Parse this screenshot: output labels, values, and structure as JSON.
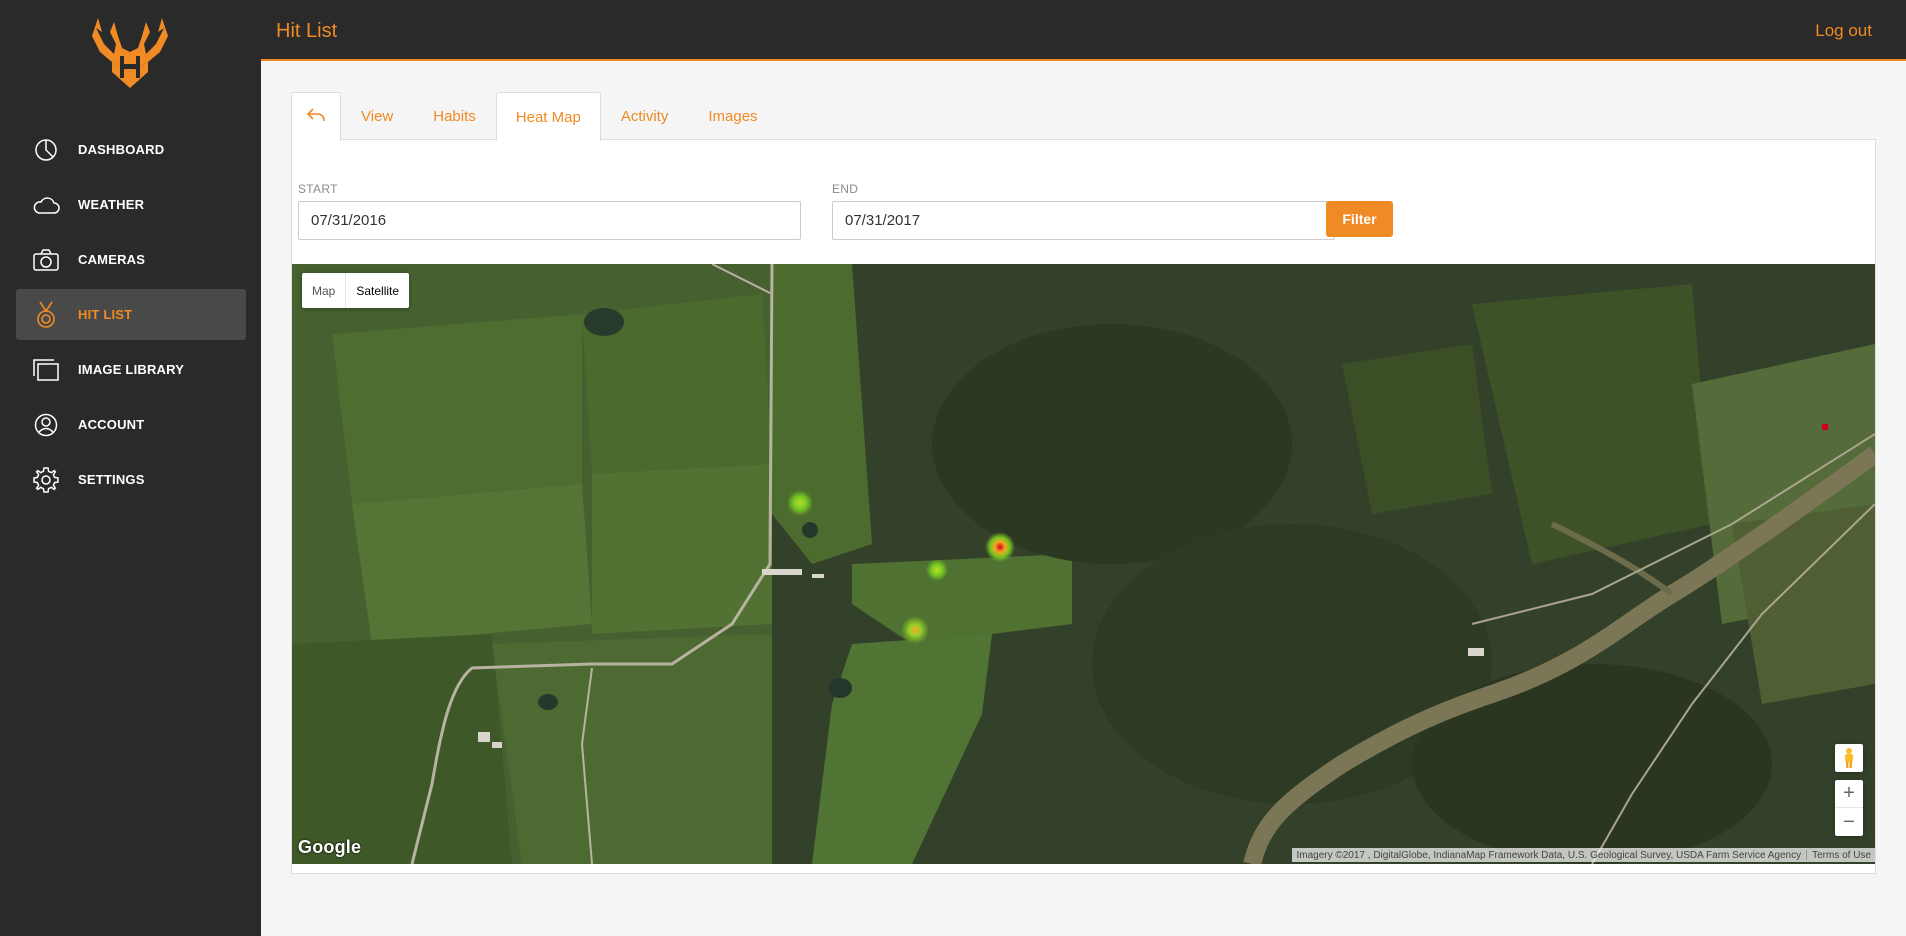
{
  "header": {
    "title": "Hit List",
    "logout_label": "Log out"
  },
  "sidebar": {
    "items": [
      {
        "label": "DASHBOARD",
        "icon": "dashboard-pie-icon",
        "active": false
      },
      {
        "label": "WEATHER",
        "icon": "cloud-icon",
        "active": false
      },
      {
        "label": "CAMERAS",
        "icon": "camera-icon",
        "active": false
      },
      {
        "label": "HIT LIST",
        "icon": "medal-icon",
        "active": true
      },
      {
        "label": "IMAGE LIBRARY",
        "icon": "image-library-icon",
        "active": false
      },
      {
        "label": "ACCOUNT",
        "icon": "account-icon",
        "active": false
      },
      {
        "label": "SETTINGS",
        "icon": "gear-icon",
        "active": false
      }
    ]
  },
  "tabs": [
    {
      "label": "View"
    },
    {
      "label": "Habits"
    },
    {
      "label": "Heat Map",
      "active": true
    },
    {
      "label": "Activity"
    },
    {
      "label": "Images"
    }
  ],
  "filter": {
    "start_label": "START",
    "start_value": "07/31/2016",
    "end_label": "END",
    "end_value": "07/31/2017",
    "button_label": "Filter"
  },
  "map": {
    "type_map_label": "Map",
    "type_satellite_label": "Satellite",
    "selected_type": "Satellite",
    "google_label": "Google",
    "attribution": "Imagery ©2017 , DigitalGlobe, IndianaMap Framework Data, U.S. Geological Survey, USDA Farm Service Agency",
    "terms_label": "Terms of Use",
    "zoom_in_label": "+",
    "zoom_out_label": "−"
  },
  "colors": {
    "accent": "#f08a24",
    "sidebar_bg": "#2a2a2a",
    "active_item_bg": "#494949",
    "heat_low": "#7ed321",
    "heat_high": "#d0021b"
  }
}
